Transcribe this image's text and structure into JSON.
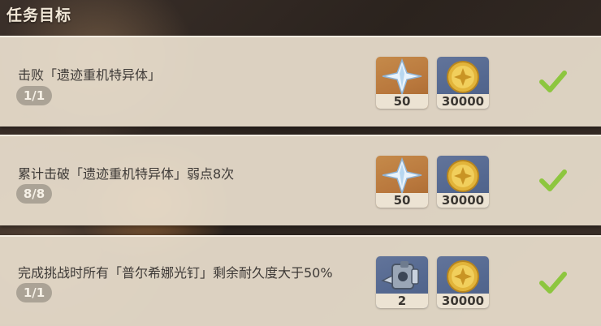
{
  "header": {
    "title": "任务目标"
  },
  "tasks": [
    {
      "name": "击败「遗迹重机特异体」",
      "progress": "1/1",
      "completed": true,
      "rewards": [
        {
          "icon": "primogem-icon",
          "count": "50"
        },
        {
          "icon": "mora-icon",
          "count": "30000"
        }
      ]
    },
    {
      "name": "累计击破「遗迹重机特异体」弱点8次",
      "progress": "8/8",
      "completed": true,
      "rewards": [
        {
          "icon": "primogem-icon",
          "count": "50"
        },
        {
          "icon": "mora-icon",
          "count": "30000"
        }
      ]
    },
    {
      "name": "完成挑战时所有「普尔希娜光钉」剩余耐久度大于50%",
      "progress": "1/1",
      "completed": true,
      "rewards": [
        {
          "icon": "gadget-icon",
          "count": "2"
        },
        {
          "icon": "mora-icon",
          "count": "30000"
        }
      ]
    }
  ],
  "colors": {
    "card": "#e9dfce",
    "pill": "#aba396",
    "check": "#8dc63f",
    "reward_gold": "#b9783d",
    "reward_blue": "#546890"
  }
}
